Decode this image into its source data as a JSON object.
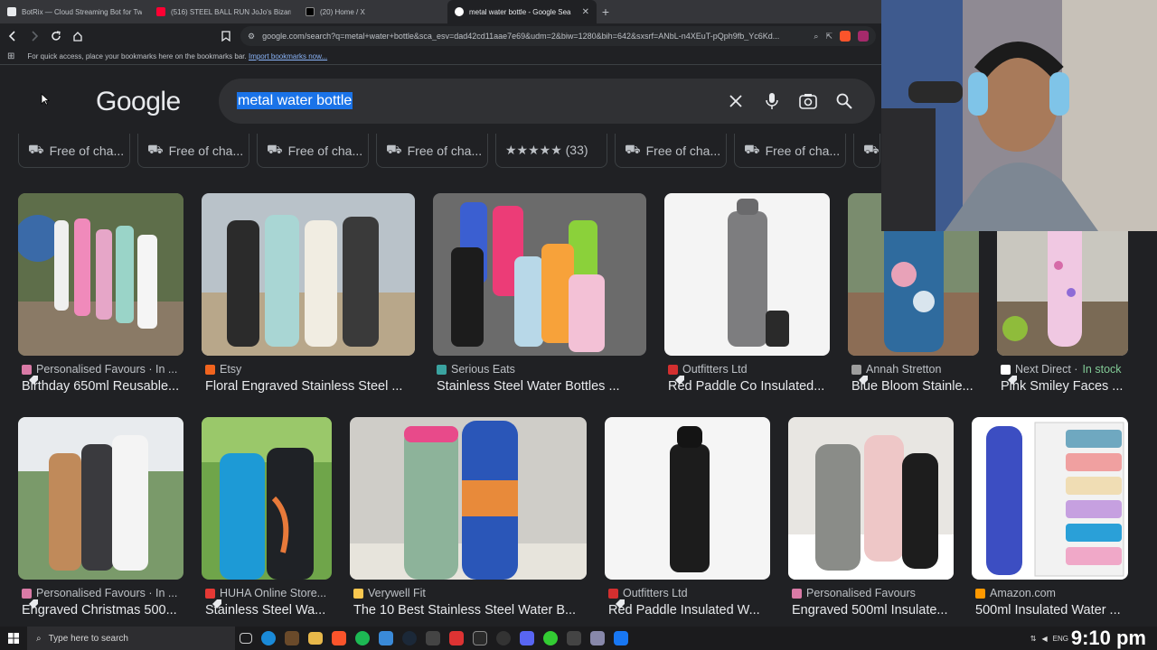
{
  "tabs": [
    {
      "title": "BotRix — Cloud Streaming Bot for Tw",
      "color": "#e8eaed"
    },
    {
      "title": "(516) STEEL BALL RUN JoJo's Bizarre",
      "color": "#ff0033"
    },
    {
      "title": "(20) Home / X",
      "color": "#ffffff"
    },
    {
      "title": "metal water bottle - Google Sea",
      "color": "#4285f4"
    }
  ],
  "address": {
    "url": "google.com/search?q=metal+water+bottle&sca_esv=dad42cd11aae7e69&udm=2&biw=1280&bih=642&sxsrf=ANbL-n4XEuT-pQph9fb_Yc6Kd..."
  },
  "bookmarks": {
    "text": "For quick access, place your bookmarks here on the bookmarks bar.",
    "import": "Import bookmarks now..."
  },
  "google": {
    "logo": "Google",
    "query": "metal water bottle"
  },
  "chips": [
    {
      "label": "Free of cha...",
      "kind": "truck"
    },
    {
      "label": "Free of cha...",
      "kind": "truck"
    },
    {
      "label": "Free of cha...",
      "kind": "truck"
    },
    {
      "label": "Free of cha...",
      "kind": "truck"
    },
    {
      "label": "★★★★★ (33)",
      "kind": "stars"
    },
    {
      "label": "Free of cha...",
      "kind": "truck"
    },
    {
      "label": "Free of cha...",
      "kind": "truck"
    }
  ],
  "results": [
    {
      "source": "Personalised Favours · In ...",
      "title": "Birthday 650ml Reusable...",
      "fav": "#d97aa6",
      "stock": "",
      "shopping": true
    },
    {
      "source": "Etsy",
      "title": "Floral Engraved Stainless Steel ...",
      "fav": "#f1641e",
      "stock": "",
      "shopping": false
    },
    {
      "source": "Serious Eats",
      "title": "Stainless Steel Water Bottles ...",
      "fav": "#3aa3a0",
      "stock": "",
      "shopping": false
    },
    {
      "source": "Outfitters Ltd",
      "title": "Red Paddle Co Insulated...",
      "fav": "#d32f2f",
      "stock": "",
      "shopping": true
    },
    {
      "source": "Annah Stretton",
      "title": "Blue Bloom Stainle...",
      "fav": "#9e9e9e",
      "stock": "",
      "shopping": true
    },
    {
      "source": "Next Direct · ",
      "title": "Pink Smiley Faces ...",
      "fav": "#ffffff",
      "stock": "In stock",
      "shopping": true
    },
    {
      "source": "Personalised Favours · In ...",
      "title": "Engraved Christmas 500...",
      "fav": "#d97aa6",
      "stock": "",
      "shopping": true
    },
    {
      "source": "HUHA Online Store...",
      "title": "Stainless Steel Wa...",
      "fav": "#e53935",
      "stock": "",
      "shopping": true
    },
    {
      "source": "Verywell Fit",
      "title": "The 10 Best Stainless Steel Water B...",
      "fav": "#f9c74f",
      "stock": "",
      "shopping": false
    },
    {
      "source": "Outfitters Ltd",
      "title": "Red Paddle Insulated W...",
      "fav": "#d32f2f",
      "stock": "",
      "shopping": true
    },
    {
      "source": "Personalised Favours",
      "title": "Engraved 500ml Insulate...",
      "fav": "#d97aa6",
      "stock": "",
      "shopping": false
    },
    {
      "source": "Amazon.com",
      "title": "500ml Insulated Water ...",
      "fav": "#ff9900",
      "stock": "",
      "shopping": false
    }
  ],
  "taskbar": {
    "search_placeholder": "Type here to search",
    "clock": "9:10 pm",
    "lang": "ENG"
  }
}
